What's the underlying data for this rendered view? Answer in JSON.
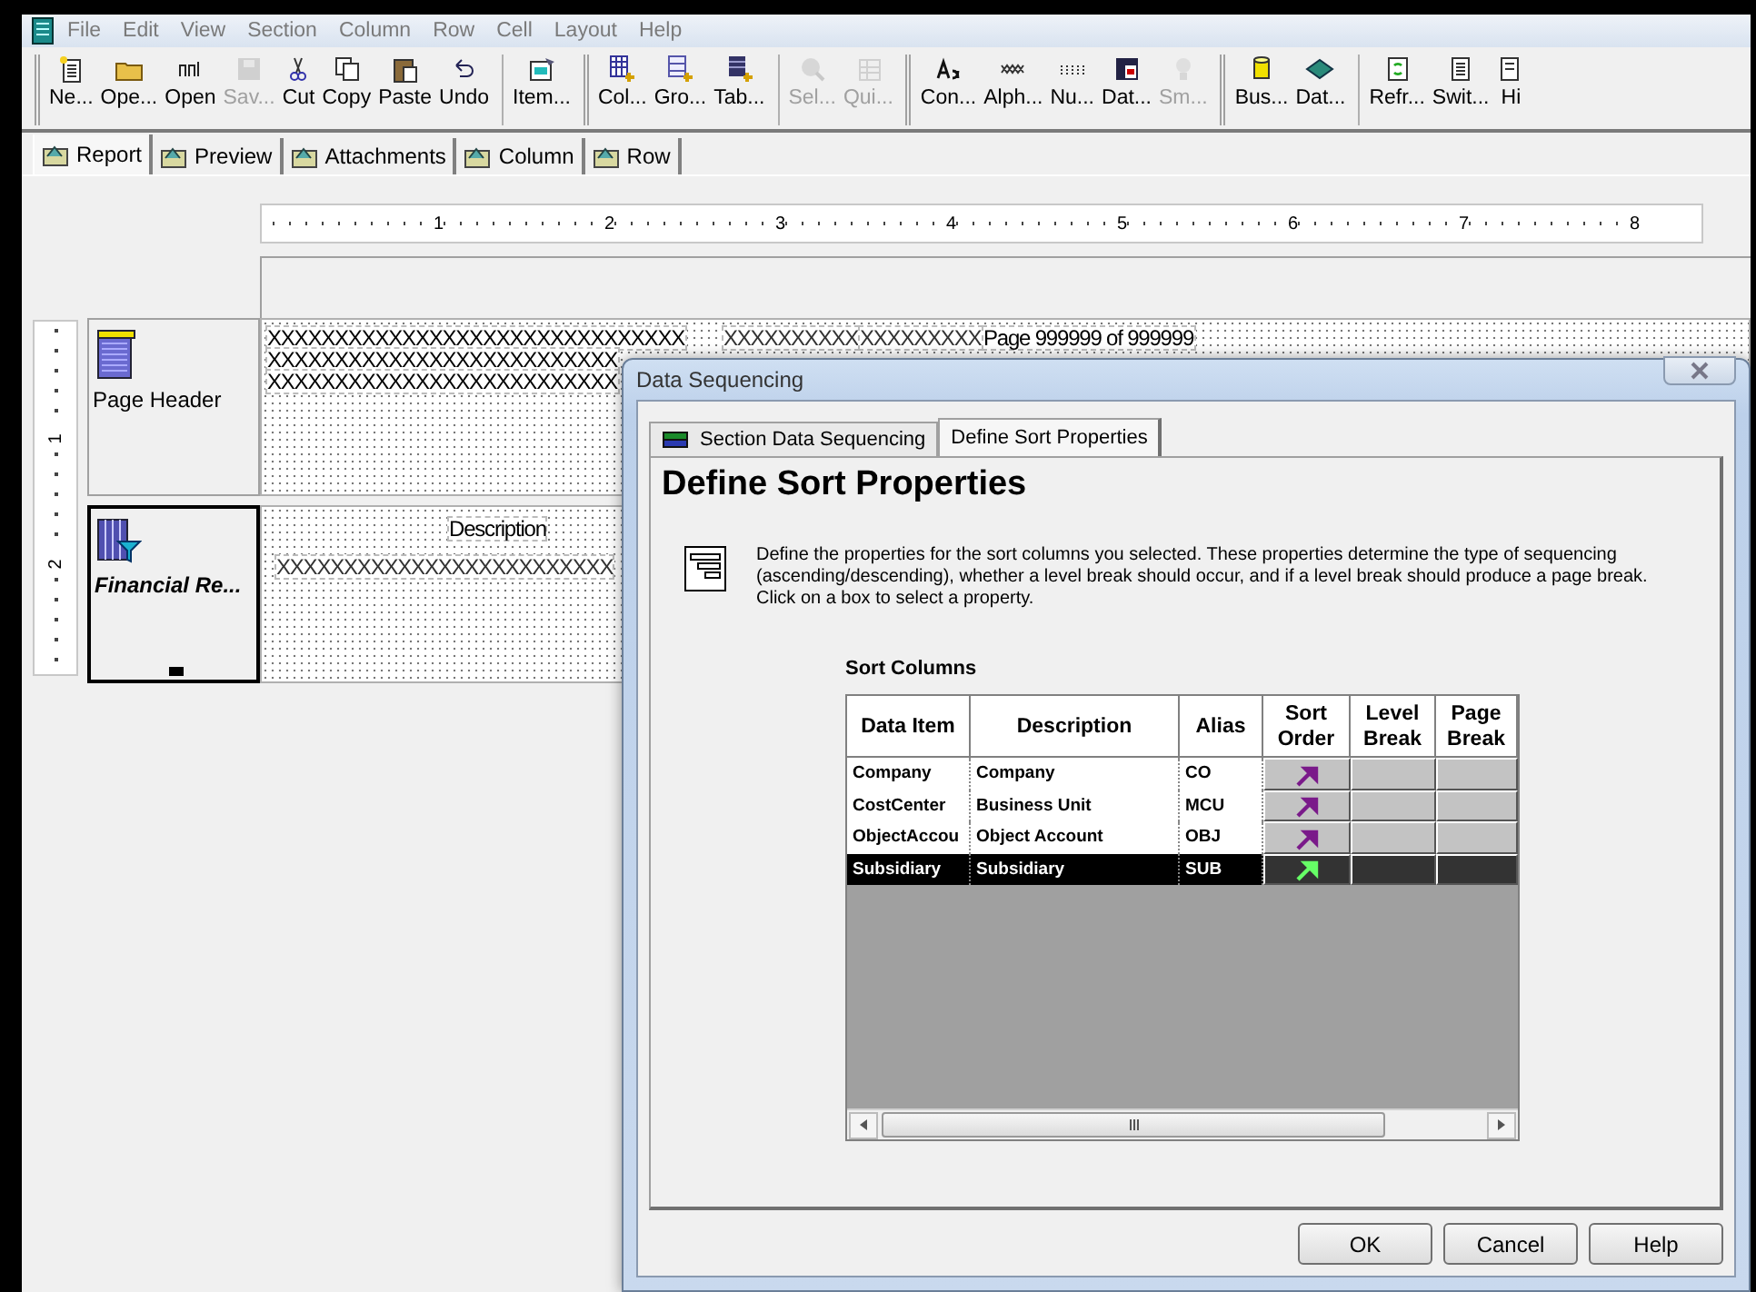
{
  "menu_bar": {
    "items": [
      "File",
      "Edit",
      "View",
      "Section",
      "Column",
      "Row",
      "Cell",
      "Layout",
      "Help"
    ]
  },
  "toolbar": {
    "groups": [
      [
        {
          "label": "Ne...",
          "disabled": false
        },
        {
          "label": "Ope...",
          "disabled": false
        },
        {
          "label": "Open",
          "disabled": false
        },
        {
          "label": "Sav...",
          "disabled": true
        },
        {
          "label": "Cut",
          "disabled": false
        },
        {
          "label": "Copy",
          "disabled": false
        },
        {
          "label": "Paste",
          "disabled": false
        },
        {
          "label": "Undo",
          "disabled": false
        }
      ],
      [
        {
          "label": "Item...",
          "disabled": false
        }
      ],
      [
        {
          "label": "Col...",
          "disabled": false
        },
        {
          "label": "Gro...",
          "disabled": false
        },
        {
          "label": "Tab...",
          "disabled": false
        }
      ],
      [
        {
          "label": "Sel...",
          "disabled": true
        },
        {
          "label": "Qui...",
          "disabled": true
        }
      ],
      [
        {
          "label": "Con...",
          "disabled": false
        },
        {
          "label": "Alph...",
          "disabled": false
        },
        {
          "label": "Nu...",
          "disabled": false
        },
        {
          "label": "Dat...",
          "disabled": false
        },
        {
          "label": "Sm...",
          "disabled": true
        }
      ],
      [
        {
          "label": "Bus...",
          "disabled": false
        },
        {
          "label": "Dat...",
          "disabled": false
        }
      ],
      [
        {
          "label": "Refr...",
          "disabled": false
        },
        {
          "label": "Swit...",
          "disabled": false
        },
        {
          "label": "Hi",
          "disabled": false
        }
      ]
    ]
  },
  "view_tabs": [
    {
      "label": "Report",
      "selected": true
    },
    {
      "label": "Preview",
      "selected": false
    },
    {
      "label": "Attachments",
      "selected": false
    },
    {
      "label": "Column",
      "selected": false
    },
    {
      "label": "Row",
      "selected": false
    }
  ],
  "ruler": {
    "marks": [
      "1",
      "2",
      "3",
      "4",
      "5",
      "6",
      "7",
      "8"
    ]
  },
  "vertical_ruler": {
    "marks": [
      "1",
      "2"
    ]
  },
  "sections": [
    {
      "kind": "header",
      "label": "Page Header",
      "selected": false,
      "title_lines": [
        "XXXXXXXXXXXXXXXXXXXXXXXXXXXXXXX",
        "XXXXXXXXXXXXXXXXXXXXXXXXXX",
        "XXXXXXXXXXXXXXXXXXXXXXXXXX"
      ],
      "fields": [
        "XXXXXXXXXX",
        "XXXXXXXXX",
        "Page 999999 of 999999"
      ]
    },
    {
      "kind": "detail",
      "label": "Financial Re...",
      "selected": true,
      "column_heading": "Description",
      "field": "XXXXXXXXXXXXXXXXXXXXXXXXX"
    }
  ],
  "dialog": {
    "title": "Data Sequencing",
    "tabs": [
      {
        "label": "Section Data Sequencing",
        "selected": false
      },
      {
        "label": "Define Sort Properties",
        "selected": true
      }
    ],
    "heading": "Define Sort Properties",
    "description": "Define the properties for the sort columns you selected.  These properties determine the type of sequencing (ascending/descending),  whether a level break should occur, and if a level break should produce a page break. Click on a box to select a property.",
    "table": {
      "title": "Sort Columns",
      "columns": [
        "Data Item",
        "Description",
        "Alias",
        "Sort Order",
        "Level Break",
        "Page Break"
      ],
      "rows": [
        {
          "data_item": "Company",
          "description": "Company",
          "alias": "CO",
          "ascending": true,
          "selected": false
        },
        {
          "data_item": "CostCenter",
          "description": "Business Unit",
          "alias": "MCU",
          "ascending": true,
          "selected": false
        },
        {
          "data_item": "ObjectAccou",
          "description": "Object Account",
          "alias": "OBJ",
          "ascending": true,
          "selected": false
        },
        {
          "data_item": "Subsidiary",
          "description": "Subsidiary",
          "alias": "SUB",
          "ascending": true,
          "selected": true
        }
      ]
    },
    "buttons": [
      "OK",
      "Cancel",
      "Help"
    ]
  }
}
